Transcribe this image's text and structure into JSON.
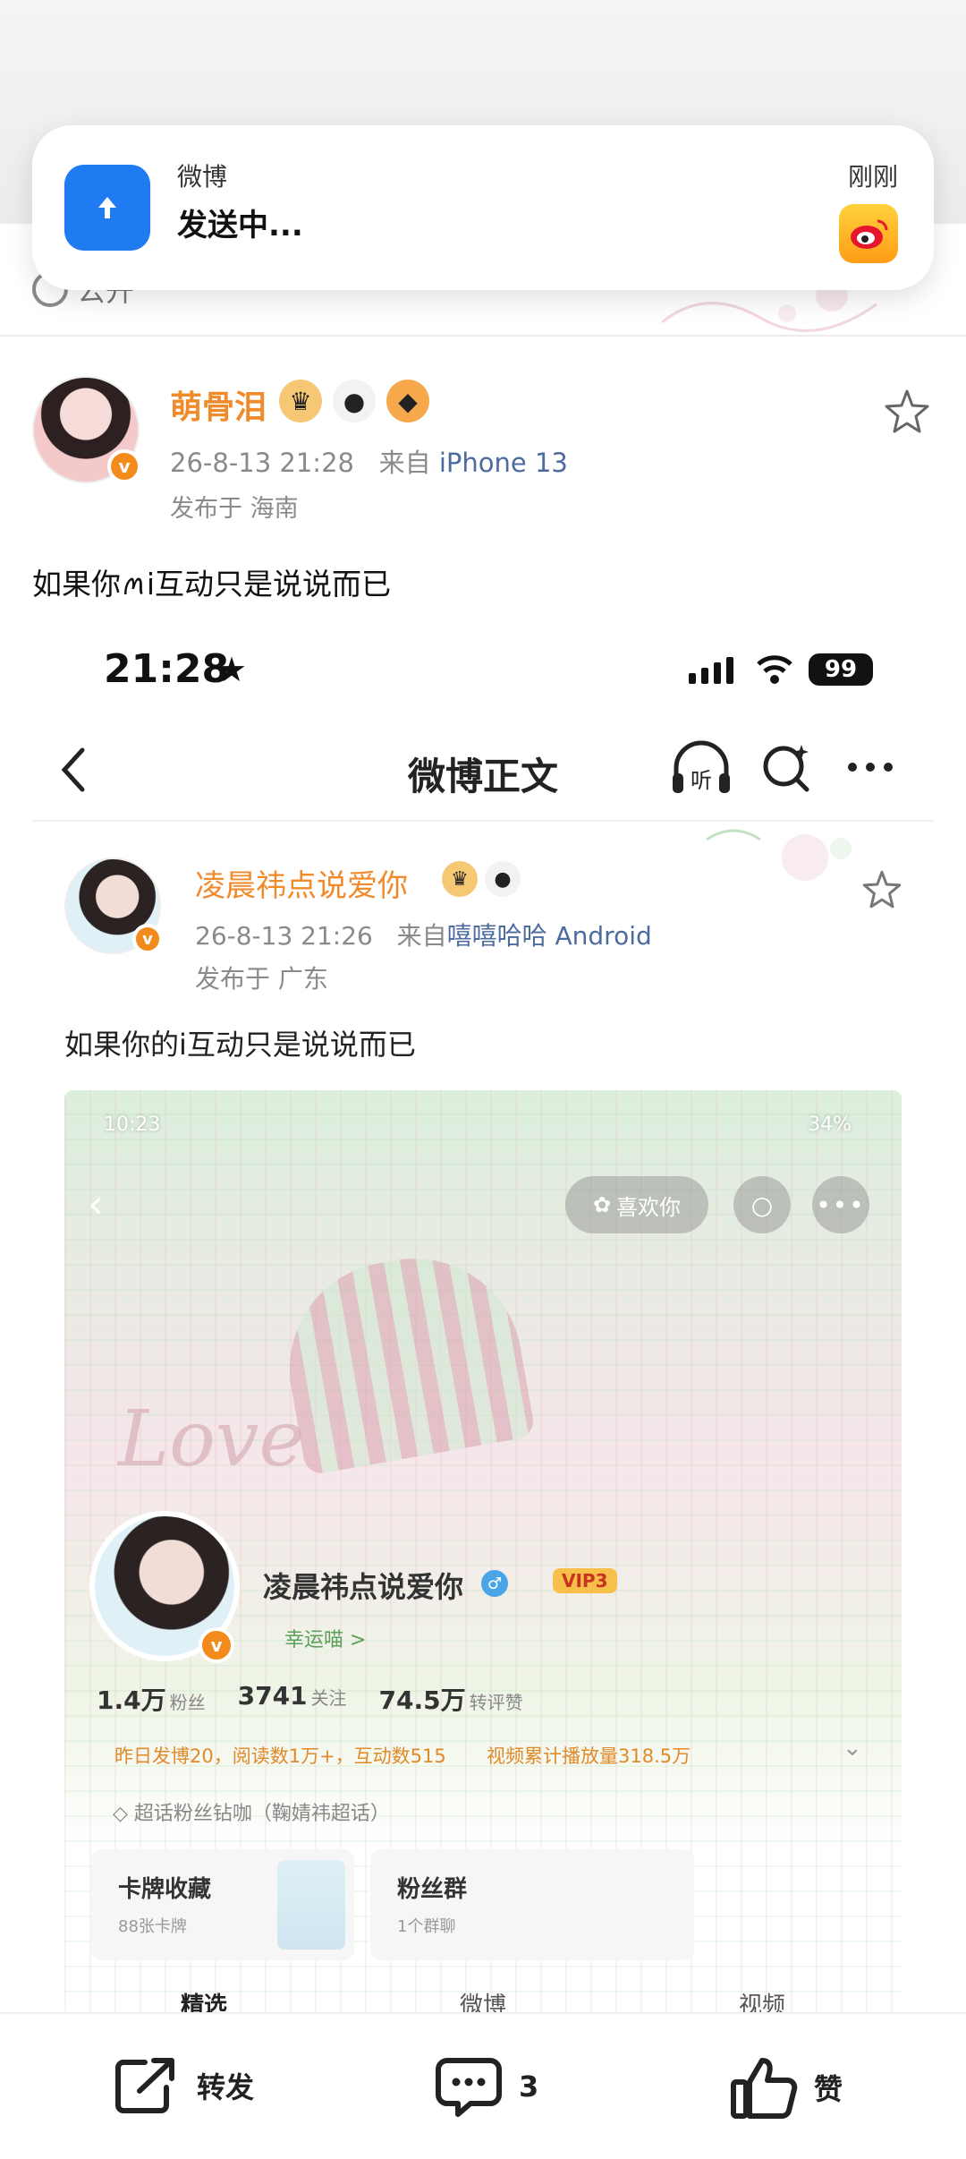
{
  "notification": {
    "app_name": "微博",
    "message": "发送中...",
    "time": "刚刚"
  },
  "outer_post": {
    "visibility": "公开",
    "author_name": "萌骨泪",
    "timestamp": "26-8-13 21:28",
    "source_prefix": "来自",
    "source": "iPhone 13",
    "location": "发布于 海南",
    "text": "如果你ꪔi互动只是说说而已"
  },
  "inner_status_bar": {
    "time": "21:28",
    "star": "★",
    "battery": "99"
  },
  "inner_nav": {
    "title": "微博正文",
    "listen_label": "听"
  },
  "inner_post": {
    "author_name": "凌晨祎点说爱你",
    "timestamp": "26-8-13 21:26",
    "source_prefix": "来自",
    "source": "嘻嘻哈哈 Android",
    "location": "发布于 广东",
    "text": "如果你的i互动只是说说而已"
  },
  "embedded_profile": {
    "status_time": "10:23",
    "status_battery": "34%",
    "like_button": "喜欢你",
    "name": "凌晨祎点说爱你",
    "vip": "VIP3",
    "lucky": "幸运喵 >",
    "stats": [
      {
        "value": "1.4万",
        "label": "粉丝"
      },
      {
        "value": "3741",
        "label": "关注"
      },
      {
        "value": "74.5万",
        "label": "转评赞"
      }
    ],
    "daily_summary": "昨日发博20，阅读数1万+，互动数515",
    "video_summary": "视频累计播放量318.5万",
    "super_fan": "超话粉丝钻咖（鞠婧祎超话）",
    "card_collection_title": "卡牌收藏",
    "card_collection_sub": "88张卡牌",
    "fan_group_title": "粉丝群",
    "fan_group_sub": "1个群聊",
    "tabs": [
      "精选",
      "微博",
      "视频"
    ]
  },
  "toolbar": {
    "repost_label": "转发",
    "comment_count": "3",
    "like_label": "赞"
  },
  "colors": {
    "accent_orange": "#f08a2b",
    "link_blue": "#4c6b9f",
    "notif_blue": "#1f7bf2"
  }
}
